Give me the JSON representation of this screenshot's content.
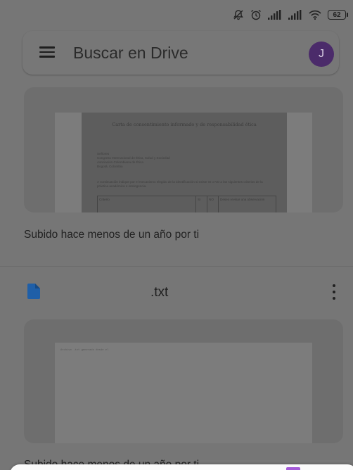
{
  "search": {
    "placeholder": "Buscar en Drive",
    "avatar_initial": "J"
  },
  "status_bar": {
    "battery_level": "62",
    "icons": [
      "mute-icon",
      "alarm-icon",
      "signal-icon",
      "signal-icon",
      "wifi-icon",
      "battery-icon"
    ]
  },
  "files": [
    {
      "name": "",
      "caption": "Subido hace menos de un año por ti",
      "preview": {
        "title": "Carta de consentimiento informado y de responsabilidad ética",
        "lines_a": [
          "Señores",
          "Congreso Internacional de Ética, Salud y Sociedad",
          "Asociación Colombiana de Ética",
          "Bogotá, Colombia"
        ],
        "lines_b": "A continuación indique por el mecanismo elegido de la identificación si existe SI o NO a las siguientes criterios de la práctica académica e intelegencia.",
        "table_headers": [
          "Criterio",
          "Si",
          "NO",
          "Deseo revisar una observación"
        ]
      }
    },
    {
      "name": ".txt",
      "caption": "Subido hace menos de un año por ti",
      "preview": {
        "first_line": "Archivo .txt generado desde el"
      }
    }
  ],
  "colors": {
    "doc_icon": "#1f5fa8",
    "avatar": "#4b2b6a",
    "accent": "#a45ad8"
  }
}
